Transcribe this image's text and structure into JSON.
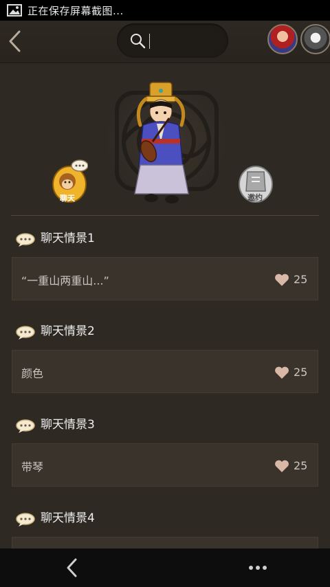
{
  "statusbar": {
    "text": "正在保存屏幕截图...",
    "icon": "image-icon"
  },
  "header": {
    "search": {
      "placeholder": "",
      "value": ""
    },
    "icons": [
      "back-arrow-icon",
      "search-icon"
    ]
  },
  "hero": {
    "chat_label": "聊天",
    "invite_label": "邀约"
  },
  "scenes": [
    {
      "title": "聊天情景1",
      "text": "“一重山两重山...”",
      "likes": "25"
    },
    {
      "title": "聊天情景2",
      "text": "颜色",
      "likes": "25"
    },
    {
      "title": "聊天情景3",
      "text": "带琴",
      "likes": "25"
    },
    {
      "title": "聊天情景4"
    }
  ],
  "colors": {
    "accent": "#f0b32c",
    "background": "#2e2923",
    "card": "#3a332b",
    "heart": "#d9b8a8"
  }
}
